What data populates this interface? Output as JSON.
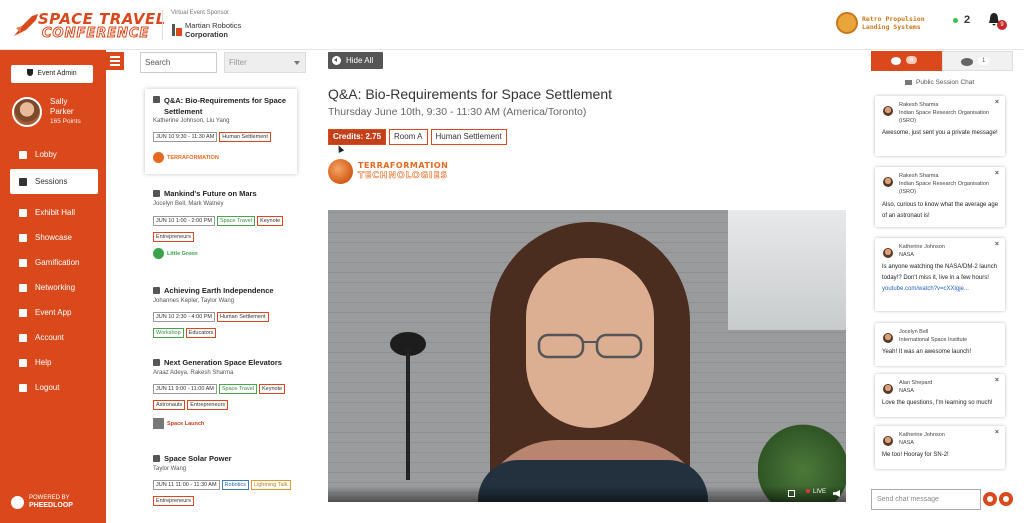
{
  "header": {
    "logo_line1": "SPACE TRAVEL",
    "logo_line2": "CONFERENCE",
    "sponsor_label": "Virtual Event Sponsor",
    "sponsor_name_1": "Martian Robotics",
    "sponsor_name_2": "Corporation",
    "retro_line1": "Retro Propulsion",
    "retro_line2": "Landing Systems",
    "online_count": "2",
    "notification_count": "9"
  },
  "sidebar": {
    "event_admin": "Event Admin",
    "user_first": "Sally",
    "user_last": "Parker",
    "points": "165 Points",
    "items": [
      {
        "label": "Lobby",
        "icon": "home-icon"
      },
      {
        "label": "Sessions",
        "icon": "calendar-icon"
      },
      {
        "label": "Exhibit Hall",
        "icon": "booth-icon"
      },
      {
        "label": "Showcase",
        "icon": "showcase-icon"
      },
      {
        "label": "Gamification",
        "icon": "trophy-icon"
      },
      {
        "label": "Networking",
        "icon": "chat-icon"
      },
      {
        "label": "Event App",
        "icon": "mobile-icon"
      },
      {
        "label": "Account",
        "icon": "gear-icon"
      },
      {
        "label": "Help",
        "icon": "info-icon"
      },
      {
        "label": "Logout",
        "icon": "logout-icon"
      }
    ],
    "powered_by": "POWERED BY",
    "powered_brand": "PHEEDLOOP"
  },
  "sessions": {
    "search_placeholder": "Search",
    "filter_label": "Filter",
    "list": [
      {
        "title": "Q&A: Bio-Requirements for Space Settlement",
        "speakers": "Katherine Johnson, Liu Yang",
        "tags": [
          "JUN 10 9:30 - 11:30 AM",
          "Human Settlement"
        ],
        "sponsor": "TERRAFORMATION"
      },
      {
        "title": "Mankind's Future on Mars",
        "speakers": "Jocelyn Bell, Mark Watney",
        "tags": [
          "JUN 10 1:00 - 2:00 PM",
          "Space Travel",
          "Keynote",
          "Entrepreneurs"
        ],
        "sponsor": "Little Green"
      },
      {
        "title": "Achieving Earth Independence",
        "speakers": "Johannes Kepler, Taylor Wang",
        "tags": [
          "JUN 10 2:30 - 4:00 PM",
          "Human Settlement",
          "Workshop",
          "Educators"
        ]
      },
      {
        "title": "Next Generation Space Elevators",
        "speakers": "Araaz Adeya, Rakesh Sharma",
        "tags": [
          "JUN 11 9:00 - 11:00 AM",
          "Space Travel",
          "Keynote",
          "Astronauts",
          "Entrepreneurs"
        ],
        "sponsor": "Space Launch"
      },
      {
        "title": "Space Solar Power",
        "speakers": "Taylor Wang",
        "tags": [
          "JUN 11 11:00 - 11:30 AM",
          "Robotics",
          "Lightning Talk",
          "Entrepreneurs"
        ]
      }
    ]
  },
  "main": {
    "hide_all": "Hide All",
    "title": "Q&A: Bio-Requirements for Space Settlement",
    "date": "Thursday June 10th, 9:30 - 11:30 AM (America/Toronto)",
    "credits": "Credits: 2.75",
    "room": "Room A",
    "track": "Human Settlement",
    "sponsor_l1": "TERRAFORMATION",
    "sponsor_l2": "TECHNOLOGIES",
    "live": "LIVE"
  },
  "chat": {
    "tab_chat_count": "6",
    "tab_people_count": "1",
    "public_label": "Public Session Chat",
    "messages": [
      {
        "name": "Rakesh Sharma",
        "org": "Indian Space Research Organisation (ISRO)",
        "text": "Awesome, just sent you a private message!"
      },
      {
        "name": "Rakesh Sharma",
        "org": "Indian Space Research Organisation (ISRO)",
        "text": "Also, curious to know what the average age of an astronaut is!"
      },
      {
        "name": "Katherine Johnson",
        "org": "NASA",
        "text": "Is anyone watching the NASA/DM-2 launch today!? Don't miss it, live in a few hours!",
        "link": "youtube.com/watch?v=cXXlgje..."
      },
      {
        "name": "Jocelyn Bell",
        "org": "International Space Institute",
        "text": "Yeah! It was an awesome launch!"
      },
      {
        "name": "Alan Shepard",
        "org": "NASA",
        "text": "Love the questions, I'm learning so much!"
      },
      {
        "name": "Katherine Johnson",
        "org": "NASA",
        "text": "Me too! Hooray for SN-2!"
      }
    ],
    "input_placeholder": "Send chat message"
  }
}
